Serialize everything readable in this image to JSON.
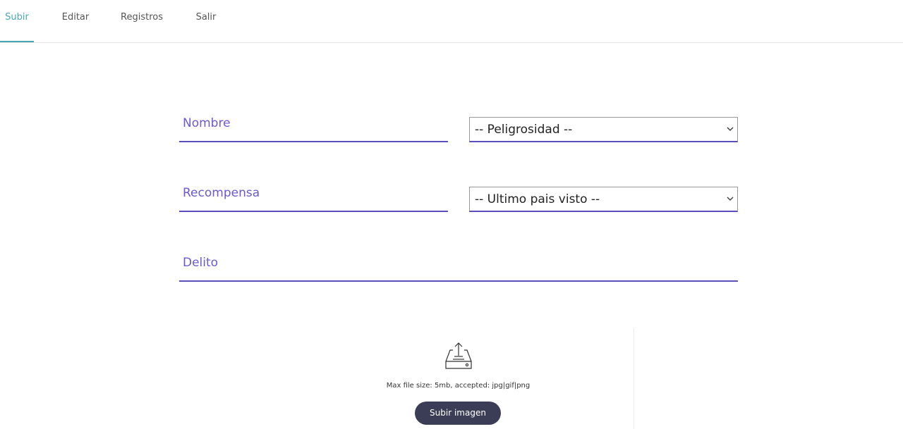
{
  "nav": {
    "tabs": [
      {
        "label": "Subir",
        "active": true
      },
      {
        "label": "Editar",
        "active": false
      },
      {
        "label": "Registros",
        "active": false
      },
      {
        "label": "Salir",
        "active": false
      }
    ]
  },
  "form": {
    "nombre": {
      "placeholder": "Nombre",
      "value": ""
    },
    "recompensa": {
      "placeholder": "Recompensa",
      "value": ""
    },
    "delito": {
      "placeholder": "Delito",
      "value": ""
    },
    "peligrosidad": {
      "selected": "-- Peligrosidad --"
    },
    "pais": {
      "selected": "-- Ultimo pais visto --"
    }
  },
  "upload": {
    "icon": "upload-tray-icon",
    "hint": "Max file size: 5mb, accepted: jpg|gif|png",
    "button_label": "Subir imagen"
  },
  "colors": {
    "accent_tab": "#4aa6b4",
    "field_line": "#5a4fb8",
    "placeholder": "#6a5acd",
    "button_bg": "#3b3d56"
  }
}
